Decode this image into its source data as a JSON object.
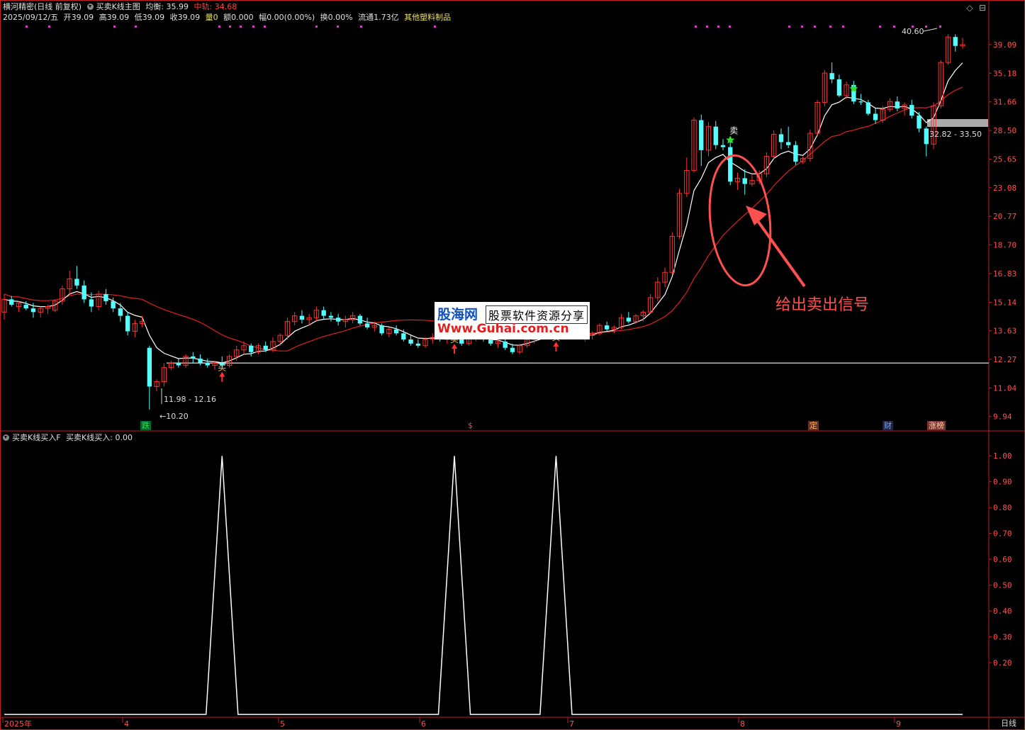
{
  "header": {
    "line1": {
      "title": "横河精密(日线 前复权)",
      "indicator": "买卖K线主图",
      "avg_label": "均衡: 35.99",
      "mid_label": "中轨: 34.68"
    },
    "line2": {
      "date": "2025/09/12/五",
      "open": "开39.09",
      "high": "高39.09",
      "low": "低39.09",
      "close": "收39.09",
      "vol": "量0",
      "amt": "额0.000",
      "chg": "幅0.00(0.00%)",
      "turnover": "换0.00%",
      "float": "流通1.73亿",
      "sector": "其他塑料制品"
    },
    "sub_title": "买卖K线买入F",
    "sub_value": "买卖K线买入: 0.00",
    "bottom_right": "日线"
  },
  "annotations": {
    "high_label": "40.60",
    "low_label": "←10.20",
    "range_low": "11.98 - 12.16",
    "range_high": "32.82 - 33.50",
    "sell_text": "卖",
    "buy_text": "买",
    "callout": "给出卖出信号",
    "badges": [
      "跌",
      "$",
      "定",
      "财",
      "涨榜"
    ]
  },
  "watermark": {
    "brand": "股海网",
    "slogan": "股票软件资源分享",
    "url": "Www.Guhai.com.cn"
  },
  "colors": {
    "up": "#ff3030",
    "down": "#54ffff",
    "ma_white": "#ffffff",
    "ma_red": "#e02020",
    "axis": "#c02020",
    "callout": "#ff5050"
  },
  "chart_data": [
    {
      "type": "candlestick",
      "title": "买卖K线主图",
      "ylim": [
        9.5,
        41.5
      ],
      "yticks": [
        "39.09",
        "35.18",
        "31.66",
        "28.50",
        "25.65",
        "23.08",
        "20.77",
        "18.70",
        "16.83",
        "15.14",
        "13.63",
        "12.27",
        "11.04",
        "9.94"
      ],
      "xticks": [
        "2025年",
        "4",
        "5",
        "6",
        "7",
        "8",
        "9"
      ],
      "candles": [
        [
          14.6,
          15.6,
          14.2,
          15.3
        ],
        [
          15.3,
          15.5,
          14.9,
          15.0
        ],
        [
          14.9,
          15.2,
          14.6,
          15.1
        ],
        [
          15.0,
          15.2,
          14.7,
          14.8
        ],
        [
          14.8,
          15.1,
          14.3,
          14.6
        ],
        [
          14.6,
          14.9,
          14.3,
          14.8
        ],
        [
          14.8,
          15.0,
          14.5,
          14.9
        ],
        [
          14.7,
          15.3,
          14.6,
          15.2
        ],
        [
          15.2,
          16.1,
          15.0,
          15.9
        ],
        [
          15.9,
          17.0,
          15.6,
          16.5
        ],
        [
          16.5,
          17.3,
          15.9,
          16.1
        ],
        [
          16.1,
          16.4,
          15.1,
          15.3
        ],
        [
          15.3,
          15.7,
          14.6,
          14.9
        ],
        [
          14.9,
          15.8,
          14.7,
          15.6
        ],
        [
          15.6,
          15.9,
          15.0,
          15.2
        ],
        [
          15.2,
          15.4,
          14.6,
          14.8
        ],
        [
          14.8,
          15.1,
          14.1,
          14.4
        ],
        [
          14.4,
          14.6,
          13.4,
          13.6
        ],
        [
          13.6,
          14.2,
          13.3,
          14.0
        ],
        [
          14.0,
          14.4,
          13.8,
          14.1
        ],
        [
          12.8,
          12.9,
          10.2,
          11.1
        ],
        [
          11.1,
          11.4,
          10.9,
          11.3
        ],
        [
          11.3,
          12.1,
          11.1,
          11.9
        ],
        [
          11.9,
          12.2,
          11.8,
          12.1
        ],
        [
          12.1,
          12.3,
          11.9,
          12.0
        ],
        [
          12.0,
          12.5,
          11.9,
          12.4
        ],
        [
          12.4,
          12.6,
          12.1,
          12.3
        ],
        [
          12.3,
          12.5,
          12.0,
          12.1
        ],
        [
          12.1,
          12.3,
          11.9,
          12.0
        ],
        [
          12.0,
          12.2,
          11.8,
          12.1
        ],
        [
          12.1,
          12.4,
          11.9,
          12.0
        ],
        [
          12.0,
          12.5,
          11.9,
          12.4
        ],
        [
          12.4,
          12.9,
          12.2,
          12.7
        ],
        [
          12.7,
          13.1,
          12.5,
          12.9
        ],
        [
          12.9,
          13.0,
          12.4,
          12.6
        ],
        [
          12.6,
          13.0,
          12.5,
          12.9
        ],
        [
          12.9,
          13.1,
          12.6,
          12.7
        ],
        [
          12.7,
          13.3,
          12.6,
          13.1
        ],
        [
          13.1,
          13.5,
          12.9,
          13.4
        ],
        [
          13.4,
          14.3,
          13.2,
          14.1
        ],
        [
          14.1,
          14.6,
          13.9,
          14.4
        ],
        [
          14.4,
          14.7,
          14.0,
          14.2
        ],
        [
          14.2,
          14.5,
          13.9,
          14.3
        ],
        [
          14.3,
          14.9,
          14.1,
          14.7
        ],
        [
          14.7,
          14.9,
          14.2,
          14.4
        ],
        [
          14.4,
          14.6,
          14.1,
          14.3
        ],
        [
          14.3,
          14.5,
          13.9,
          14.1
        ],
        [
          14.1,
          14.4,
          13.8,
          14.2
        ],
        [
          14.2,
          14.6,
          14.0,
          14.4
        ],
        [
          14.4,
          14.5,
          13.9,
          14.0
        ],
        [
          14.0,
          14.3,
          13.7,
          13.8
        ],
        [
          13.8,
          14.1,
          13.6,
          13.9
        ],
        [
          13.9,
          14.0,
          13.4,
          13.5
        ],
        [
          13.5,
          13.8,
          13.3,
          13.7
        ],
        [
          13.7,
          13.9,
          13.4,
          13.5
        ],
        [
          13.5,
          13.7,
          13.1,
          13.2
        ],
        [
          13.2,
          13.4,
          12.9,
          13.0
        ],
        [
          13.0,
          13.2,
          12.8,
          12.9
        ],
        [
          12.9,
          13.3,
          12.8,
          13.2
        ],
        [
          13.2,
          13.5,
          13.0,
          13.3
        ],
        [
          13.3,
          13.6,
          13.1,
          13.2
        ],
        [
          13.2,
          13.5,
          13.0,
          13.4
        ],
        [
          13.4,
          13.7,
          13.2,
          13.3
        ],
        [
          13.3,
          13.5,
          12.9,
          13.0
        ],
        [
          13.0,
          13.4,
          12.9,
          13.3
        ],
        [
          13.3,
          13.6,
          13.1,
          13.5
        ],
        [
          13.5,
          13.7,
          13.1,
          13.2
        ],
        [
          13.2,
          13.4,
          12.9,
          13.0
        ],
        [
          13.0,
          13.3,
          12.8,
          13.1
        ],
        [
          13.1,
          13.3,
          12.7,
          12.8
        ],
        [
          12.8,
          13.0,
          12.5,
          12.6
        ],
        [
          12.6,
          13.0,
          12.5,
          12.9
        ],
        [
          12.9,
          13.3,
          12.8,
          13.2
        ],
        [
          13.2,
          13.5,
          13.0,
          13.4
        ],
        [
          13.4,
          13.6,
          13.2,
          13.5
        ],
        [
          13.5,
          13.7,
          13.3,
          13.6
        ],
        [
          13.6,
          13.8,
          13.3,
          13.4
        ],
        [
          13.4,
          13.6,
          13.2,
          13.5
        ],
        [
          13.5,
          13.7,
          13.3,
          13.4
        ],
        [
          13.4,
          13.6,
          13.2,
          13.3
        ],
        [
          13.3,
          13.5,
          13.1,
          13.4
        ],
        [
          13.4,
          13.6,
          13.2,
          13.5
        ],
        [
          13.5,
          14.0,
          13.4,
          13.9
        ],
        [
          13.9,
          14.1,
          13.6,
          13.7
        ],
        [
          13.7,
          13.9,
          13.5,
          13.8
        ],
        [
          13.8,
          14.5,
          13.7,
          14.3
        ],
        [
          14.3,
          14.6,
          14.0,
          14.1
        ],
        [
          14.1,
          14.5,
          14.0,
          14.4
        ],
        [
          14.4,
          14.7,
          14.1,
          14.6
        ],
        [
          14.6,
          15.6,
          14.5,
          15.4
        ],
        [
          15.4,
          16.6,
          15.2,
          16.3
        ],
        [
          16.3,
          17.2,
          16.0,
          16.9
        ],
        [
          16.9,
          19.6,
          16.8,
          19.3
        ],
        [
          19.3,
          23.0,
          19.1,
          22.6
        ],
        [
          22.6,
          25.8,
          22.3,
          24.6
        ],
        [
          24.6,
          29.9,
          24.4,
          29.6
        ],
        [
          29.6,
          30.2,
          25.0,
          26.5
        ],
        [
          26.5,
          29.4,
          25.9,
          28.9
        ],
        [
          28.9,
          29.5,
          26.6,
          27.0
        ],
        [
          27.0,
          27.6,
          26.5,
          26.8
        ],
        [
          26.8,
          27.3,
          23.3,
          23.6
        ],
        [
          23.6,
          24.4,
          22.9,
          23.9
        ],
        [
          23.9,
          24.7,
          22.5,
          23.4
        ],
        [
          23.4,
          24.2,
          23.2,
          23.7
        ],
        [
          23.7,
          24.6,
          23.4,
          24.3
        ],
        [
          24.3,
          26.3,
          24.0,
          25.9
        ],
        [
          25.9,
          28.5,
          25.6,
          28.1
        ],
        [
          28.1,
          28.7,
          26.6,
          27.3
        ],
        [
          27.3,
          28.9,
          26.7,
          27.0
        ],
        [
          27.0,
          27.4,
          25.1,
          25.4
        ],
        [
          25.4,
          25.9,
          25.2,
          25.7
        ],
        [
          25.7,
          28.6,
          25.4,
          28.2
        ],
        [
          28.2,
          31.9,
          27.9,
          31.6
        ],
        [
          31.6,
          35.6,
          31.1,
          35.2
        ],
        [
          35.2,
          36.6,
          33.9,
          34.4
        ],
        [
          34.4,
          35.0,
          32.2,
          32.4
        ],
        [
          32.4,
          34.1,
          32.0,
          33.7
        ],
        [
          33.7,
          34.2,
          31.4,
          31.7
        ],
        [
          31.7,
          32.6,
          31.3,
          31.6
        ],
        [
          31.6,
          31.9,
          30.1,
          30.3
        ],
        [
          30.3,
          30.9,
          29.2,
          29.6
        ],
        [
          29.6,
          31.2,
          29.3,
          30.8
        ],
        [
          30.8,
          32.1,
          30.5,
          31.7
        ],
        [
          31.7,
          32.3,
          30.6,
          30.9
        ],
        [
          30.9,
          31.6,
          30.1,
          31.3
        ],
        [
          31.3,
          31.9,
          29.8,
          30.1
        ],
        [
          30.1,
          30.5,
          28.3,
          28.7
        ],
        [
          28.7,
          28.9,
          25.9,
          27.1
        ],
        [
          27.1,
          31.6,
          26.6,
          31.2
        ],
        [
          31.2,
          36.9,
          30.9,
          36.6
        ],
        [
          36.6,
          40.6,
          36.3,
          40.2
        ],
        [
          40.2,
          40.6,
          38.1,
          38.9
        ],
        [
          38.9,
          40.1,
          38.5,
          39.09
        ]
      ],
      "series": [
        {
          "name": "白线",
          "values": "computed from candles (short average)"
        },
        {
          "name": "中轨",
          "values": "computed from candles (long average)"
        }
      ],
      "support_line": 12.1,
      "buy_signal_indices": [
        30,
        62,
        76
      ],
      "sell_signal_indices": [
        100
      ]
    },
    {
      "type": "line",
      "title": "买卖K线买入F",
      "ylim": [
        0,
        1.05
      ],
      "yticks": [
        "1.00",
        "0.90",
        "0.80",
        "0.70",
        "0.60",
        "0.50",
        "0.40",
        "0.30",
        "0.20"
      ],
      "series": [
        {
          "name": "买卖K线买入",
          "spikes_at_indices": [
            30,
            62,
            76
          ],
          "spike_value": 1.0,
          "base_value": 0.0
        }
      ]
    }
  ]
}
